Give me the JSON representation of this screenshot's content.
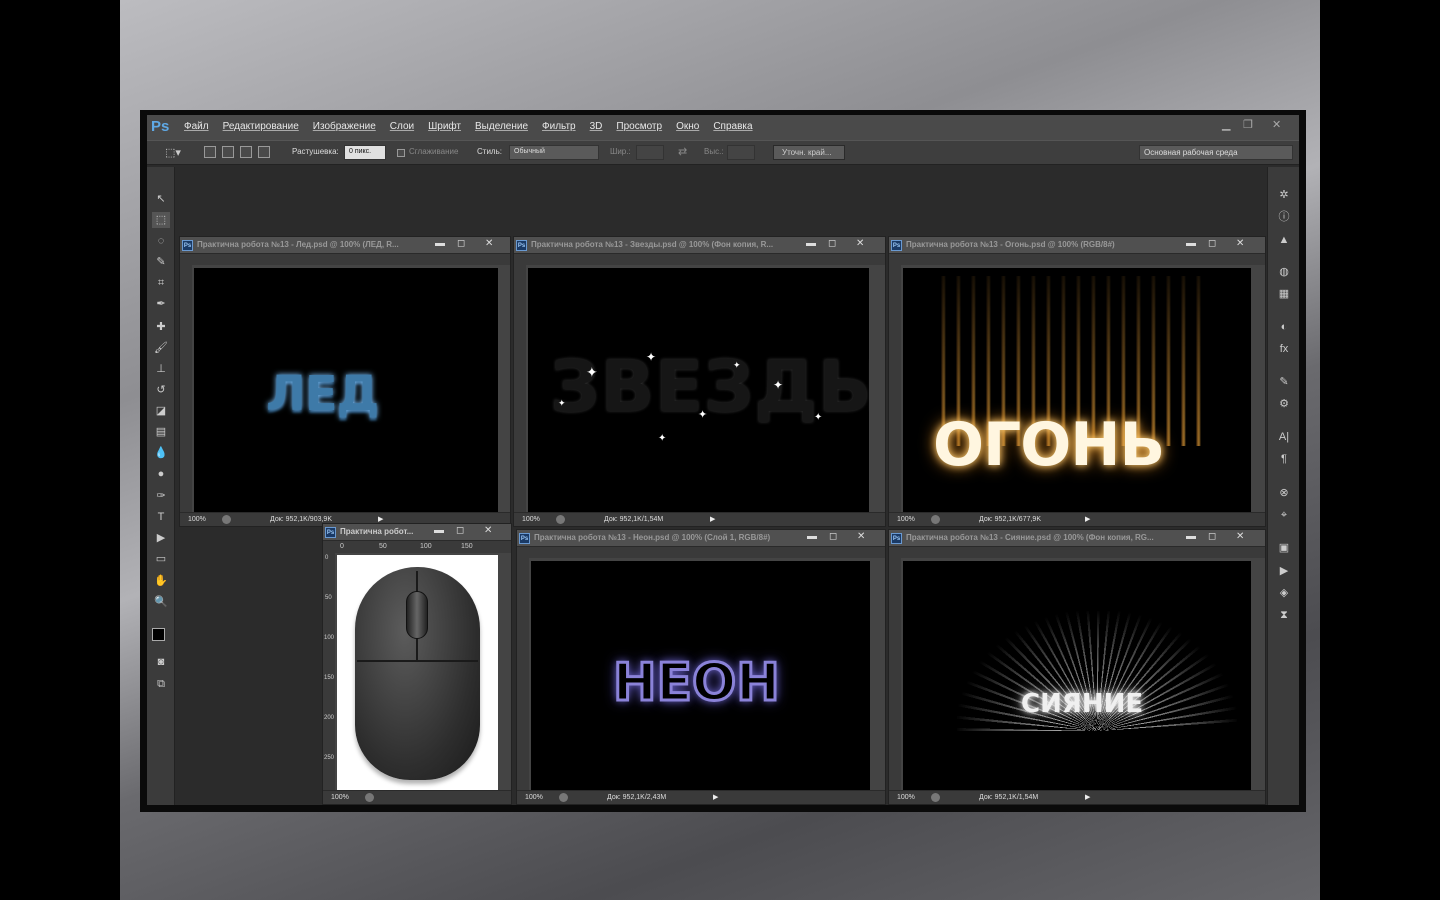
{
  "app": {
    "logo": "Ps",
    "menu": [
      "Файл",
      "Редактирование",
      "Изображение",
      "Слои",
      "Шрифт",
      "Выделение",
      "Фильтр",
      "3D",
      "Просмотр",
      "Окно",
      "Справка"
    ]
  },
  "options": {
    "feather_label": "Растушевка:",
    "feather_value": "0 пикс.",
    "antialias_label": "Сглаживание",
    "style_label": "Стиль:",
    "style_value": "Обычный",
    "width_label": "Шир.:",
    "height_label": "Выс.:",
    "refine_edge": "Уточн. край...",
    "workspace": "Основная рабочая среда"
  },
  "docs": {
    "led": {
      "title": "Практична робота №13 - Лед.psd @ 100% (ЛЕД, R...",
      "zoom": "100%",
      "info": "Док: 952,1K/903,9K",
      "art": "ЛЕД"
    },
    "stars": {
      "title": "Практична робота №13 - Звезды.psd @ 100% (Фон копия, R...",
      "zoom": "100%",
      "info": "Док: 952,1K/1,54M",
      "art": "ЗВЕЗДЫ"
    },
    "fire": {
      "title": "Практична робота №13 - Огонь.psd @ 100% (RGB/8#)",
      "zoom": "100%",
      "info": "Док: 952,1K/677,9K",
      "art": "ОГОНЬ"
    },
    "mouse": {
      "title": "Практична робот...",
      "zoom": "100%",
      "ruler_h": [
        "0",
        "50",
        "100",
        "150"
      ],
      "ruler_v": [
        "0",
        "50",
        "100",
        "150",
        "200",
        "250"
      ]
    },
    "neon": {
      "title": "Практична робота №13 - Неон.psd @ 100% (Слой 1, RGB/8#)",
      "zoom": "100%",
      "info": "Док: 952,1K/2,43M",
      "art": "НЕОН"
    },
    "shine": {
      "title": "Практична робота №13 - Сияние.psd @ 100% (Фон копия, RG...",
      "zoom": "100%",
      "info": "Док: 952,1K/1,54M",
      "art": "СИЯНИЕ"
    }
  },
  "colors": {
    "ps_blue": "#5fa8e4",
    "ice": "#3f7fb0",
    "neon": "#7b73c9",
    "fire": "#f2b040"
  }
}
